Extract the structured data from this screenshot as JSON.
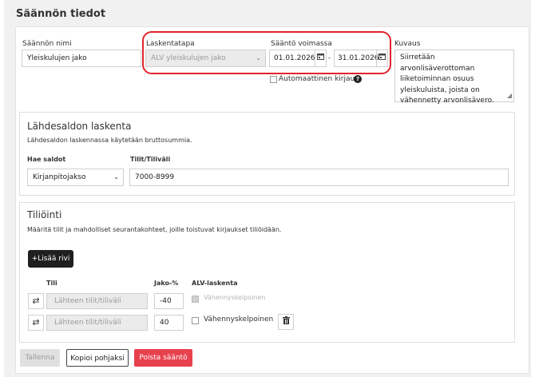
{
  "page": {
    "title": "Säännön tiedot"
  },
  "rule": {
    "name_label": "Säännön nimi",
    "name_value": "Yleiskulujen jako",
    "method_label": "Laskentatapa",
    "method_value": "ALV yleiskulujen jako",
    "validity_label": "Sääntö voimassa",
    "date_from": "01.01.2026",
    "date_sep": "-",
    "date_to": "31.01.2026",
    "auto_booking_label": "Automaattinen kirjaus",
    "description_label": "Kuvaus",
    "description_value": "Siirretään arvonlisäverottoman liiketoiminnan osuus yleiskuluista, joista on vähennetty arvonlisävero."
  },
  "source_balance": {
    "title": "Lähdesaldon laskenta",
    "description": "Lähdesaldon laskennassa käytetään bruttosummia.",
    "fetch_label": "Hae saldot",
    "fetch_value": "Kirjanpitojakso",
    "accounts_label": "Tilit/Tiliväli",
    "accounts_value": "7000-8999"
  },
  "posting": {
    "title": "Tiliöinti",
    "description": "Määritä tilit ja mahdolliset seurantakohteet, joille toistuvat kirjaukset tiliöidään.",
    "add_row_label": "+Lisää rivi",
    "col_account": "Tili",
    "col_share": "Jako-%",
    "col_vat": "ALV-laskenta",
    "rows": [
      {
        "account_placeholder": "Lähteen tilit/tiliväli",
        "share": "-40",
        "vat_label": "Vähennyskelpoinen",
        "vat_checked": true,
        "disabled": true
      },
      {
        "account_placeholder": "Lähteen tilit/tiliväli",
        "share": "40",
        "vat_label": "Vähennyskelpoinen",
        "vat_checked": false,
        "disabled": false
      }
    ]
  },
  "actions": {
    "save_label": "Tallenna",
    "copy_label": "Kopioi pohjaksi",
    "delete_label": "Poista sääntö"
  },
  "icons": {
    "swap": "swap-icon",
    "calendar": "calendar-icon",
    "help": "help-icon",
    "trash": "trash-icon"
  },
  "colors": {
    "danger": "#e8414e",
    "highlight": "#e0242d",
    "add_button": "#1f1f1f"
  }
}
